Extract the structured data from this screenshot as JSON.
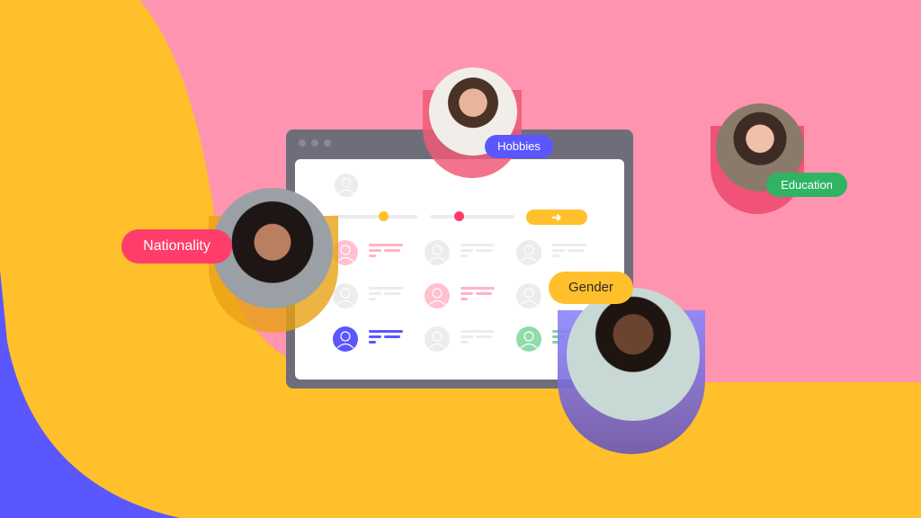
{
  "colors": {
    "blue": "#5b57ff",
    "yellow": "#ffc02b",
    "pink": "#ff94b0",
    "window": "#6e6e7b",
    "red": "#ff3d6a",
    "green": "#2eb463",
    "purple": "#5b57ff"
  },
  "window": {
    "go_button_icon": "arrow-right-icon",
    "go_button_glyph": "➜",
    "sliders": [
      {
        "color": "#ffc02b",
        "value": 0.6
      },
      {
        "color": "#ff3d6a",
        "value": 0.34
      }
    ]
  },
  "grid": [
    {
      "color": "#ffc0cf",
      "line": "#ffb3c6",
      "highlight": true
    },
    {
      "color": "#ececef",
      "line": "#ececef",
      "highlight": false
    },
    {
      "color": "#ececef",
      "line": "#ececef",
      "highlight": false
    },
    {
      "color": "#ececef",
      "line": "#ececef",
      "highlight": false
    },
    {
      "color": "#ffc0cf",
      "line": "#ffb3c6",
      "highlight": true
    },
    {
      "color": "#ececef",
      "line": "#ececef",
      "highlight": false
    },
    {
      "color": "#5b57ff",
      "line": "#5b57ff",
      "highlight": true
    },
    {
      "color": "#ececef",
      "line": "#ececef",
      "highlight": false
    },
    {
      "color": "#8fdcaa",
      "line": "#7ed39a",
      "highlight": true
    }
  ],
  "tags": {
    "hobbies": "Hobbies",
    "education": "Education",
    "nationality": "Nationality",
    "gender": "Gender"
  }
}
